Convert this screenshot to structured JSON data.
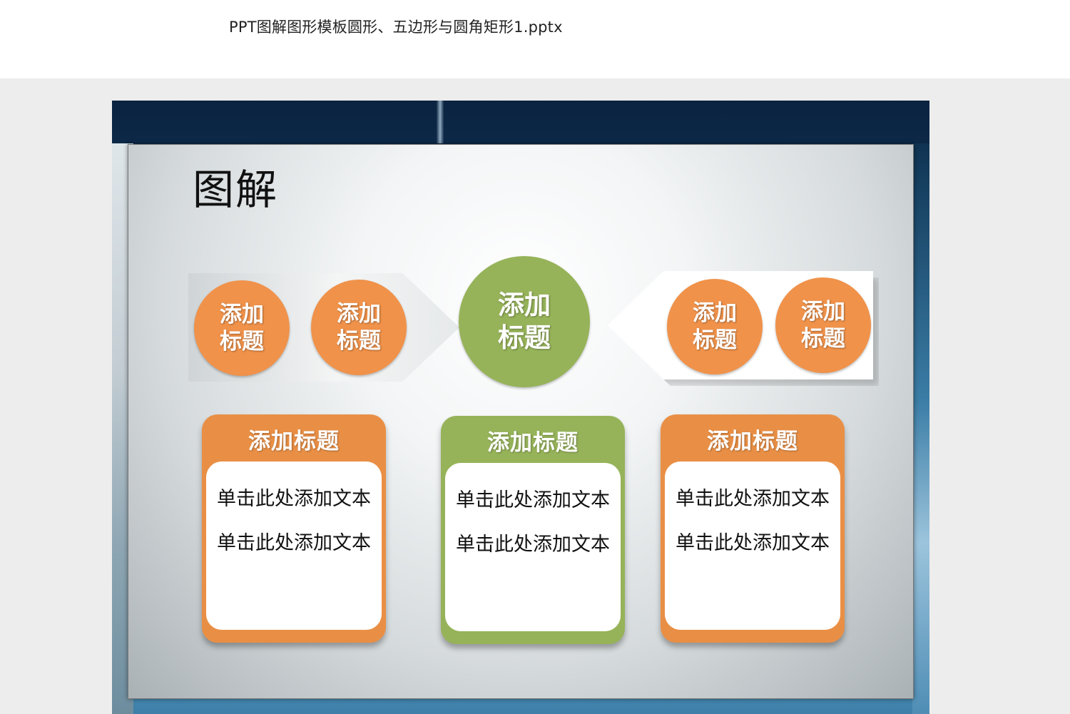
{
  "document": {
    "title": "PPT图解图形模板圆形、五边形与圆角矩形1.pptx"
  },
  "slide": {
    "heading": "图解",
    "left_group": [
      {
        "line1": "添加",
        "line2": "标题"
      },
      {
        "line1": "添加",
        "line2": "标题"
      }
    ],
    "center_circle": {
      "line1": "添加",
      "line2": "标题"
    },
    "right_group": [
      {
        "line1": "添加",
        "line2": "标题"
      },
      {
        "line1": "添加",
        "line2": "标题"
      }
    ],
    "cards": [
      {
        "title": "添加标题",
        "lines": [
          "单击此处添加文本",
          "单击此处添加文本"
        ]
      },
      {
        "title": "添加标题",
        "lines": [
          "单击此处添加文本",
          "单击此处添加文本"
        ]
      },
      {
        "title": "添加标题",
        "lines": [
          "单击此处添加文本",
          "单击此处添加文本"
        ]
      }
    ]
  },
  "colors": {
    "orange": "#f0924a",
    "card_orange": "#e98f45",
    "green": "#96b359"
  }
}
